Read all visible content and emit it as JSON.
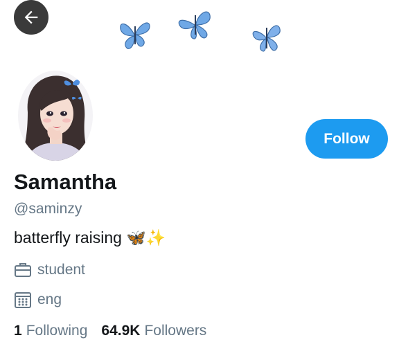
{
  "colors": {
    "accent": "#1d9bf0",
    "text_primary": "#14171a",
    "text_secondary": "#657786",
    "back_button_bg": "#3a3a3a",
    "butterfly_blue": "#6fa8e6"
  },
  "header": {
    "back_icon": "arrow-left-icon",
    "decorations": [
      "butterfly-icon",
      "butterfly-icon",
      "butterfly-icon"
    ]
  },
  "profile": {
    "name": "Samantha",
    "handle": "@saminzy",
    "bio_text": "batterfly raising",
    "bio_emoji": "🦋✨",
    "follow_label": "Follow"
  },
  "details": {
    "occupation_icon": "briefcase-icon",
    "occupation": "student",
    "joined_icon": "calendar-icon",
    "joined": "eng"
  },
  "stats": {
    "following_count": "1",
    "following_label": "Following",
    "followers_count": "64.9K",
    "followers_label": "Followers"
  }
}
